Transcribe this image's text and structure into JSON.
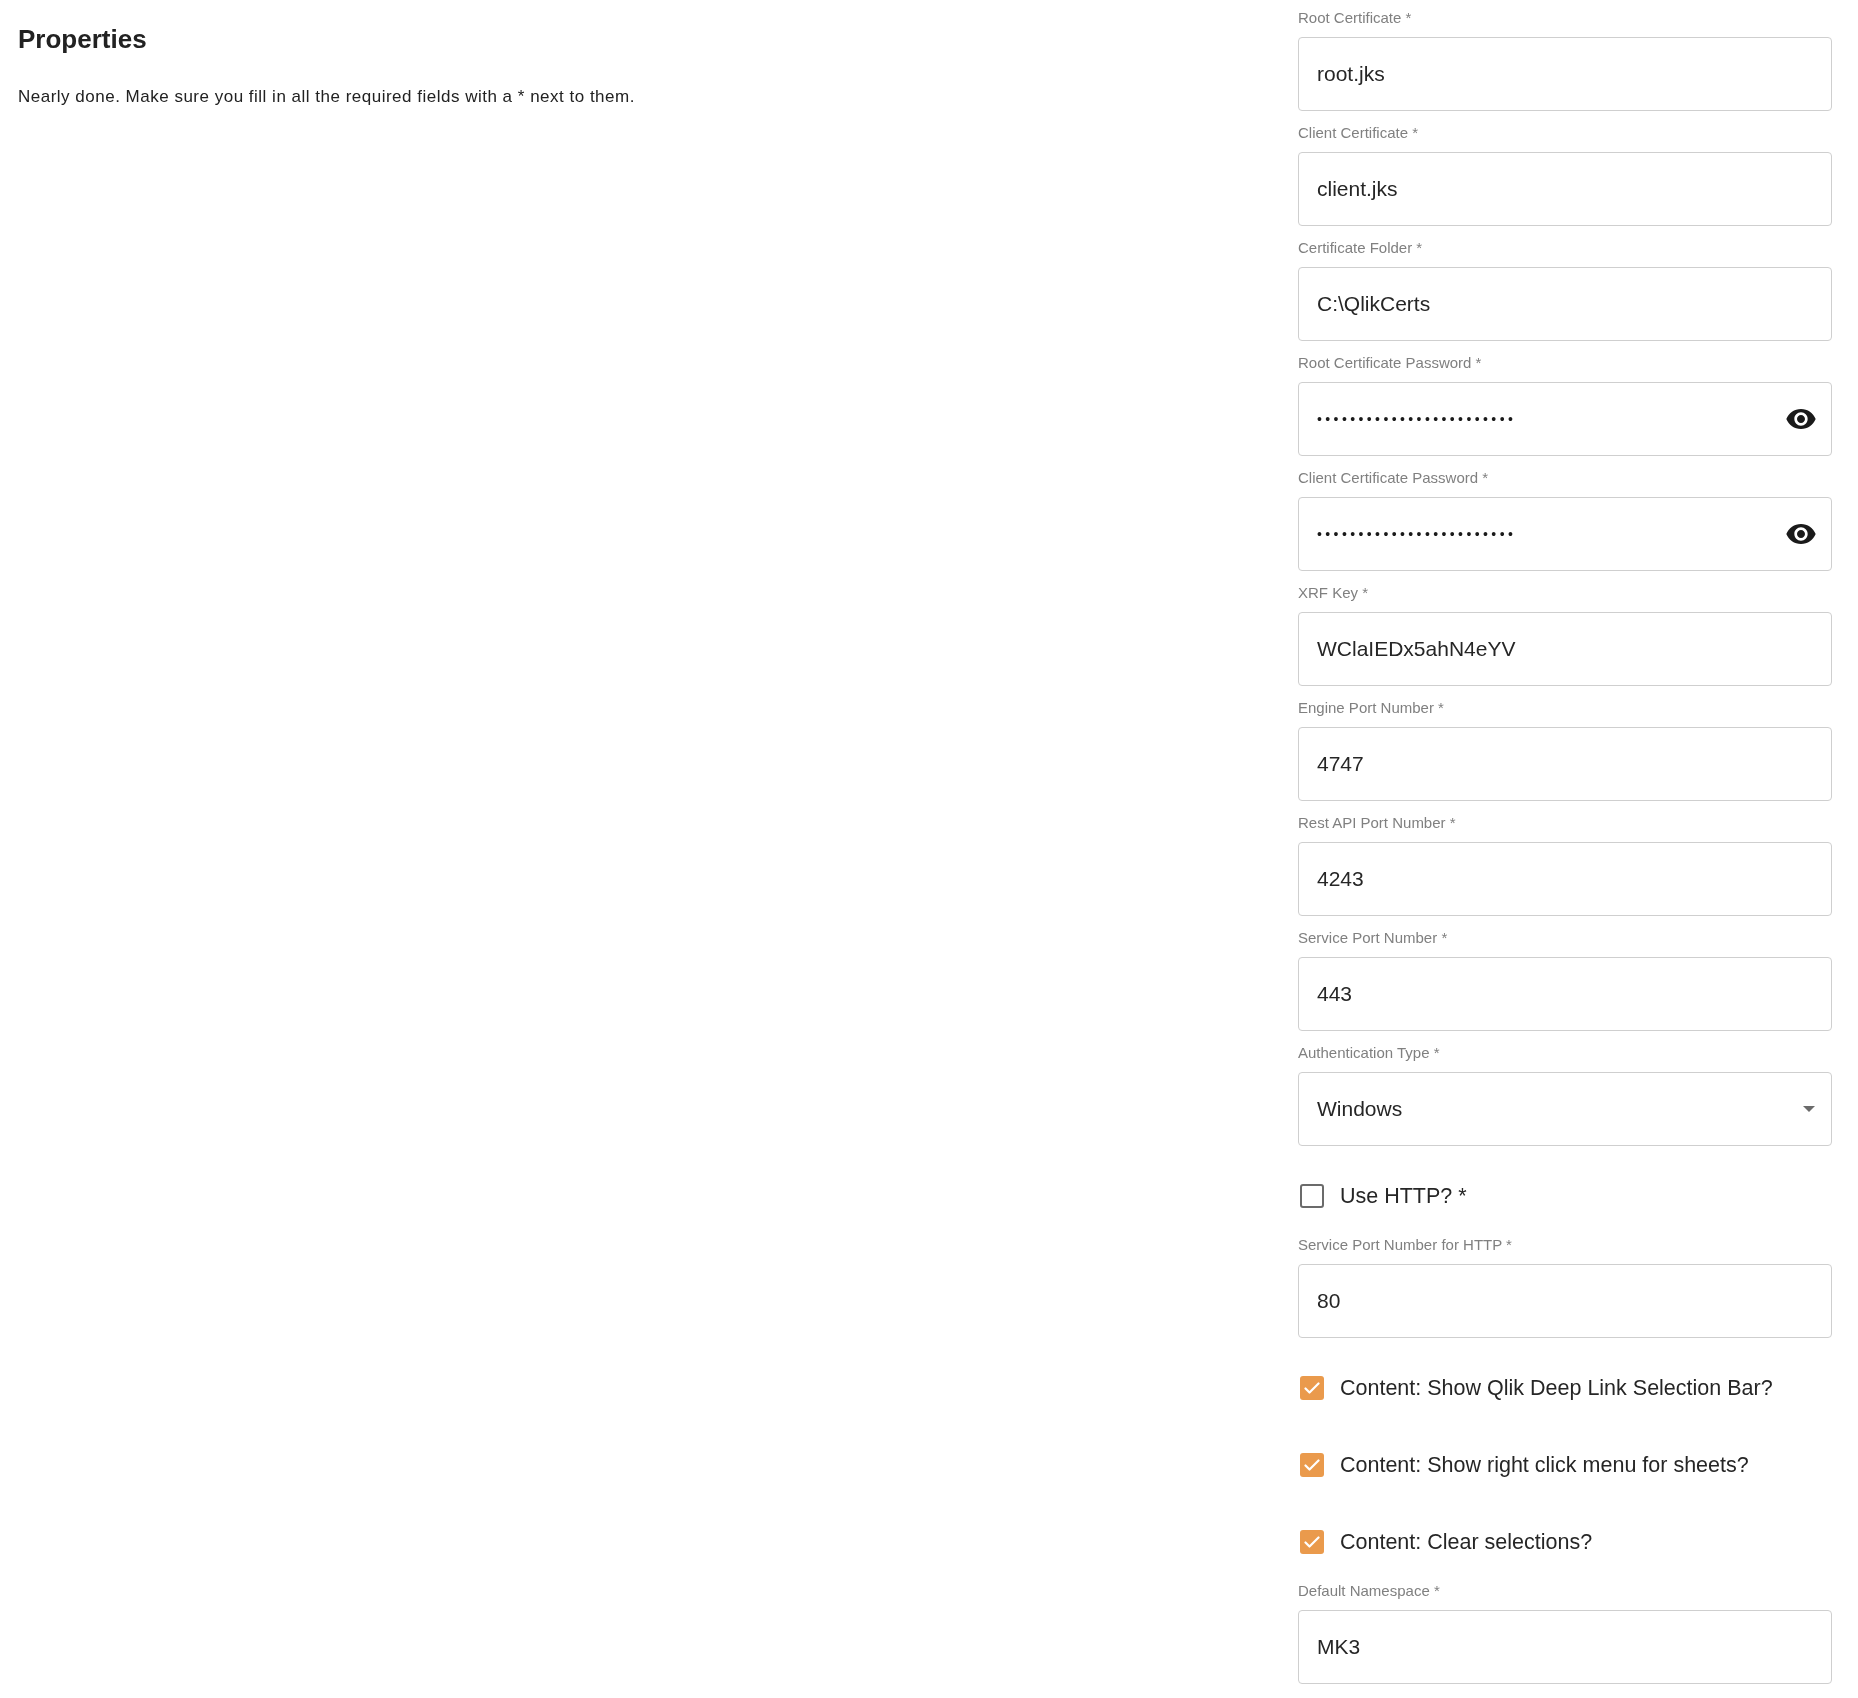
{
  "header": {
    "title": "Properties",
    "description": "Nearly done. Make sure you fill in all the required fields with a * next to them."
  },
  "form": {
    "items": [
      {
        "kind": "text",
        "label": "Root Certificate *",
        "value": "root.jks"
      },
      {
        "kind": "text",
        "label": "Client Certificate *",
        "value": "client.jks"
      },
      {
        "kind": "text",
        "label": "Certificate Folder *",
        "value": "C:\\QlikCerts"
      },
      {
        "kind": "password",
        "label": "Root Certificate Password *",
        "value": "••••••••••••••••••••••••"
      },
      {
        "kind": "password",
        "label": "Client Certificate Password *",
        "value": "••••••••••••••••••••••••"
      },
      {
        "kind": "text",
        "label": "XRF Key *",
        "value": "WClaIEDx5ahN4eYV"
      },
      {
        "kind": "text",
        "label": "Engine Port Number *",
        "value": "4747"
      },
      {
        "kind": "text",
        "label": "Rest API Port Number *",
        "value": "4243"
      },
      {
        "kind": "text",
        "label": "Service Port Number *",
        "value": "443"
      },
      {
        "kind": "select",
        "label": "Authentication Type *",
        "value": "Windows"
      },
      {
        "kind": "checkbox",
        "label": "Use HTTP? *",
        "checked": false
      },
      {
        "kind": "text",
        "label": "Service Port Number for HTTP *",
        "value": "80"
      },
      {
        "kind": "checkbox",
        "label": "Content: Show Qlik Deep Link Selection Bar?",
        "checked": true
      },
      {
        "kind": "checkbox",
        "label": "Content: Show right click menu for sheets?",
        "checked": true
      },
      {
        "kind": "checkbox",
        "label": "Content: Clear selections?",
        "checked": true
      },
      {
        "kind": "text",
        "label": "Default Namespace *",
        "value": "MK3"
      }
    ]
  }
}
